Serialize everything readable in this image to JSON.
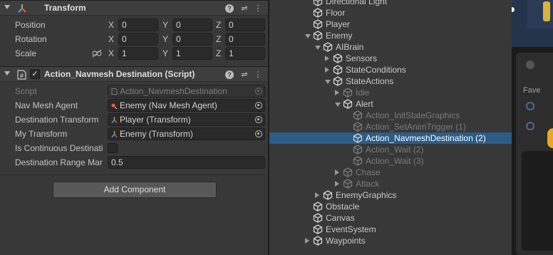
{
  "inspector": {
    "transform": {
      "title": "Transform",
      "rows": [
        {
          "label": "Position",
          "x": "0",
          "y": "0",
          "z": "0"
        },
        {
          "label": "Rotation",
          "x": "0",
          "y": "0",
          "z": "0"
        },
        {
          "label": "Scale",
          "x": "1",
          "y": "1",
          "z": "1"
        }
      ],
      "axis": {
        "x": "X",
        "y": "Y",
        "z": "Z"
      }
    },
    "script_component": {
      "title": "Action_Navmesh Destination (Script)",
      "enabled_mark": "✓",
      "script_label": "Script",
      "script_value": "Action_NavmeshDestination",
      "nav_mesh_label": "Nav Mesh Agent",
      "nav_mesh_value": "Enemy (Nav Mesh Agent)",
      "dest_transform_label": "Destination Transform",
      "dest_transform_value": "Player (Transform)",
      "my_transform_label": "My Transform",
      "my_transform_value": "Enemy (Transform)",
      "continuous_label": "Is Continuous Destinati",
      "range_label": "Destination Range Mar",
      "range_value": "0.5"
    },
    "add_component_label": "Add Component",
    "header_icons": {
      "help": "?",
      "settings": "⇌",
      "more": "⋮"
    },
    "colors": {
      "transform_icon": "#ff4a4a",
      "object_icon": "#4ca1ff"
    }
  },
  "hierarchy": {
    "items": [
      {
        "label": "Directional Light",
        "expander": "none",
        "inactive": false,
        "selected": false
      },
      {
        "label": "Floor",
        "expander": "none",
        "inactive": false,
        "selected": false
      },
      {
        "label": "Player",
        "expander": "none",
        "inactive": false,
        "selected": false
      },
      {
        "label": "Enemy",
        "expander": "down",
        "inactive": false,
        "selected": false
      },
      {
        "label": "AIBrain",
        "expander": "down",
        "inactive": false,
        "selected": false
      },
      {
        "label": "Sensors",
        "expander": "right",
        "inactive": false,
        "selected": false
      },
      {
        "label": "StateConditions",
        "expander": "right",
        "inactive": false,
        "selected": false
      },
      {
        "label": "StateActions",
        "expander": "down",
        "inactive": false,
        "selected": false
      },
      {
        "label": "Idle",
        "expander": "right",
        "inactive": true,
        "selected": false
      },
      {
        "label": "Alert",
        "expander": "down",
        "inactive": false,
        "selected": false
      },
      {
        "label": "Action_InitStateGraphics",
        "expander": "none",
        "inactive": true,
        "selected": false
      },
      {
        "label": "Action_SetAnimTrigger (1)",
        "expander": "none",
        "inactive": true,
        "selected": false
      },
      {
        "label": "Action_NavmeshDestination (2)",
        "expander": "none",
        "inactive": false,
        "selected": true
      },
      {
        "label": "Action_Wait (2)",
        "expander": "none",
        "inactive": true,
        "selected": false
      },
      {
        "label": "Action_Wait (3)",
        "expander": "none",
        "inactive": true,
        "selected": false
      },
      {
        "label": "Chase",
        "expander": "right",
        "inactive": true,
        "selected": false
      },
      {
        "label": "Attack",
        "expander": "right",
        "inactive": true,
        "selected": false
      },
      {
        "label": "EnemyGraphics",
        "expander": "right",
        "inactive": false,
        "selected": false
      },
      {
        "label": "Obstacle",
        "expander": "none",
        "inactive": false,
        "selected": false
      },
      {
        "label": "Canvas",
        "expander": "none",
        "inactive": false,
        "selected": false
      },
      {
        "label": "EventSystem",
        "expander": "none",
        "inactive": false,
        "selected": false
      },
      {
        "label": "Waypoints",
        "expander": "right",
        "inactive": false,
        "selected": false
      }
    ],
    "icon": "gameobject-cube-icon"
  },
  "sceneview": {
    "fav_label": "Fave"
  }
}
